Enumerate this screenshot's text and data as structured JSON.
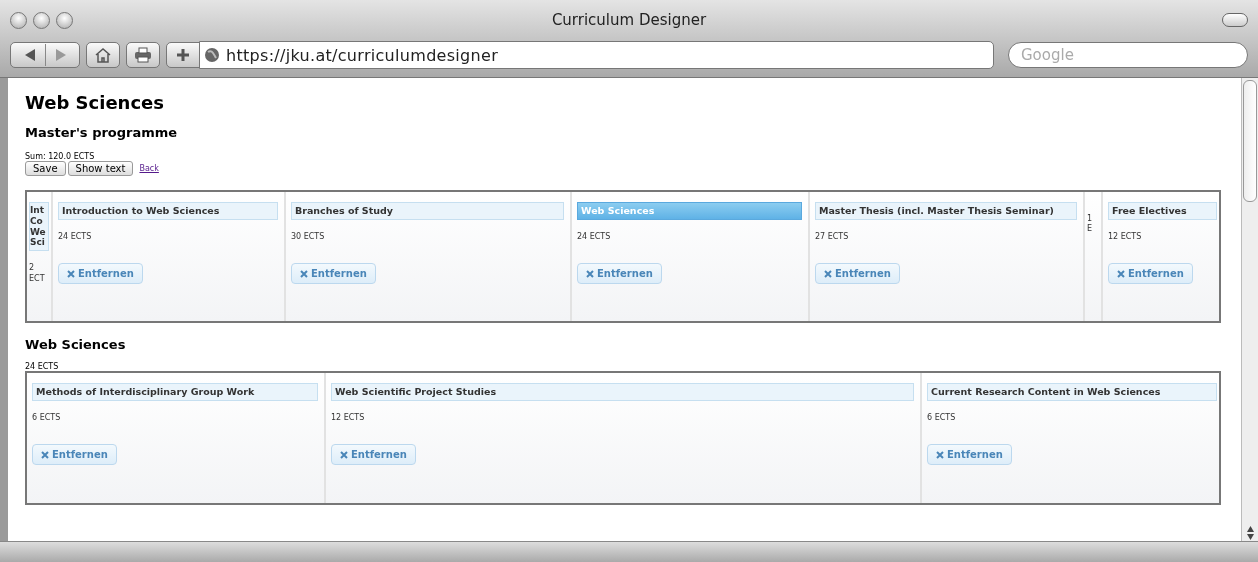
{
  "window": {
    "title": "Curriculum Designer"
  },
  "toolbar": {
    "url": "https://jku.at/curriculumdesigner",
    "search": {
      "placeholder": "Google"
    }
  },
  "page": {
    "title": "Web Sciences",
    "subtitle": "Master's programme",
    "sum": "Sum: 120.0 ECTS",
    "buttons": [
      "Save",
      "Show text"
    ],
    "link": "Back"
  },
  "curriculum": [
    {
      "kind": "collapsed",
      "title": "Int Co We Sci",
      "ects": "2 ECT",
      "selected": false
    },
    {
      "kind": "full",
      "title": "Introduction to Web Sciences",
      "ects": "24 ECTS",
      "action": "Entfernen",
      "selected": false
    },
    {
      "kind": "full",
      "title": "Branches of Study",
      "ects": "30 ECTS",
      "action": "Entfernen",
      "selected": false
    },
    {
      "kind": "full",
      "title": "Web Sciences",
      "ects": "24 ECTS",
      "action": "Entfernen",
      "selected": true
    },
    {
      "kind": "full",
      "title": "Master Thesis (incl. Master Thesis Seminar)",
      "ects": "27 ECTS",
      "action": "Entfernen",
      "selected": false
    },
    {
      "kind": "collapsed",
      "ects": "1 E"
    },
    {
      "kind": "full",
      "title": "Free Electives",
      "ects": "12 ECTS",
      "action": "Entfernen",
      "selected": false
    }
  ],
  "detail": {
    "title": "Web Sciences",
    "ects": "24 ECTS",
    "modules": [
      {
        "title": "Methods of Interdisciplinary Group Work",
        "ects": "6 ECTS",
        "action": "Entfernen",
        "selected": false
      },
      {
        "title": "Web Scientific Project Studies",
        "ects": "12 ECTS",
        "action": "Entfernen",
        "selected": false
      },
      {
        "title": "Current Research Content in Web Sciences",
        "ects": "6 ECTS",
        "action": "Entfernen",
        "selected": false
      }
    ]
  }
}
